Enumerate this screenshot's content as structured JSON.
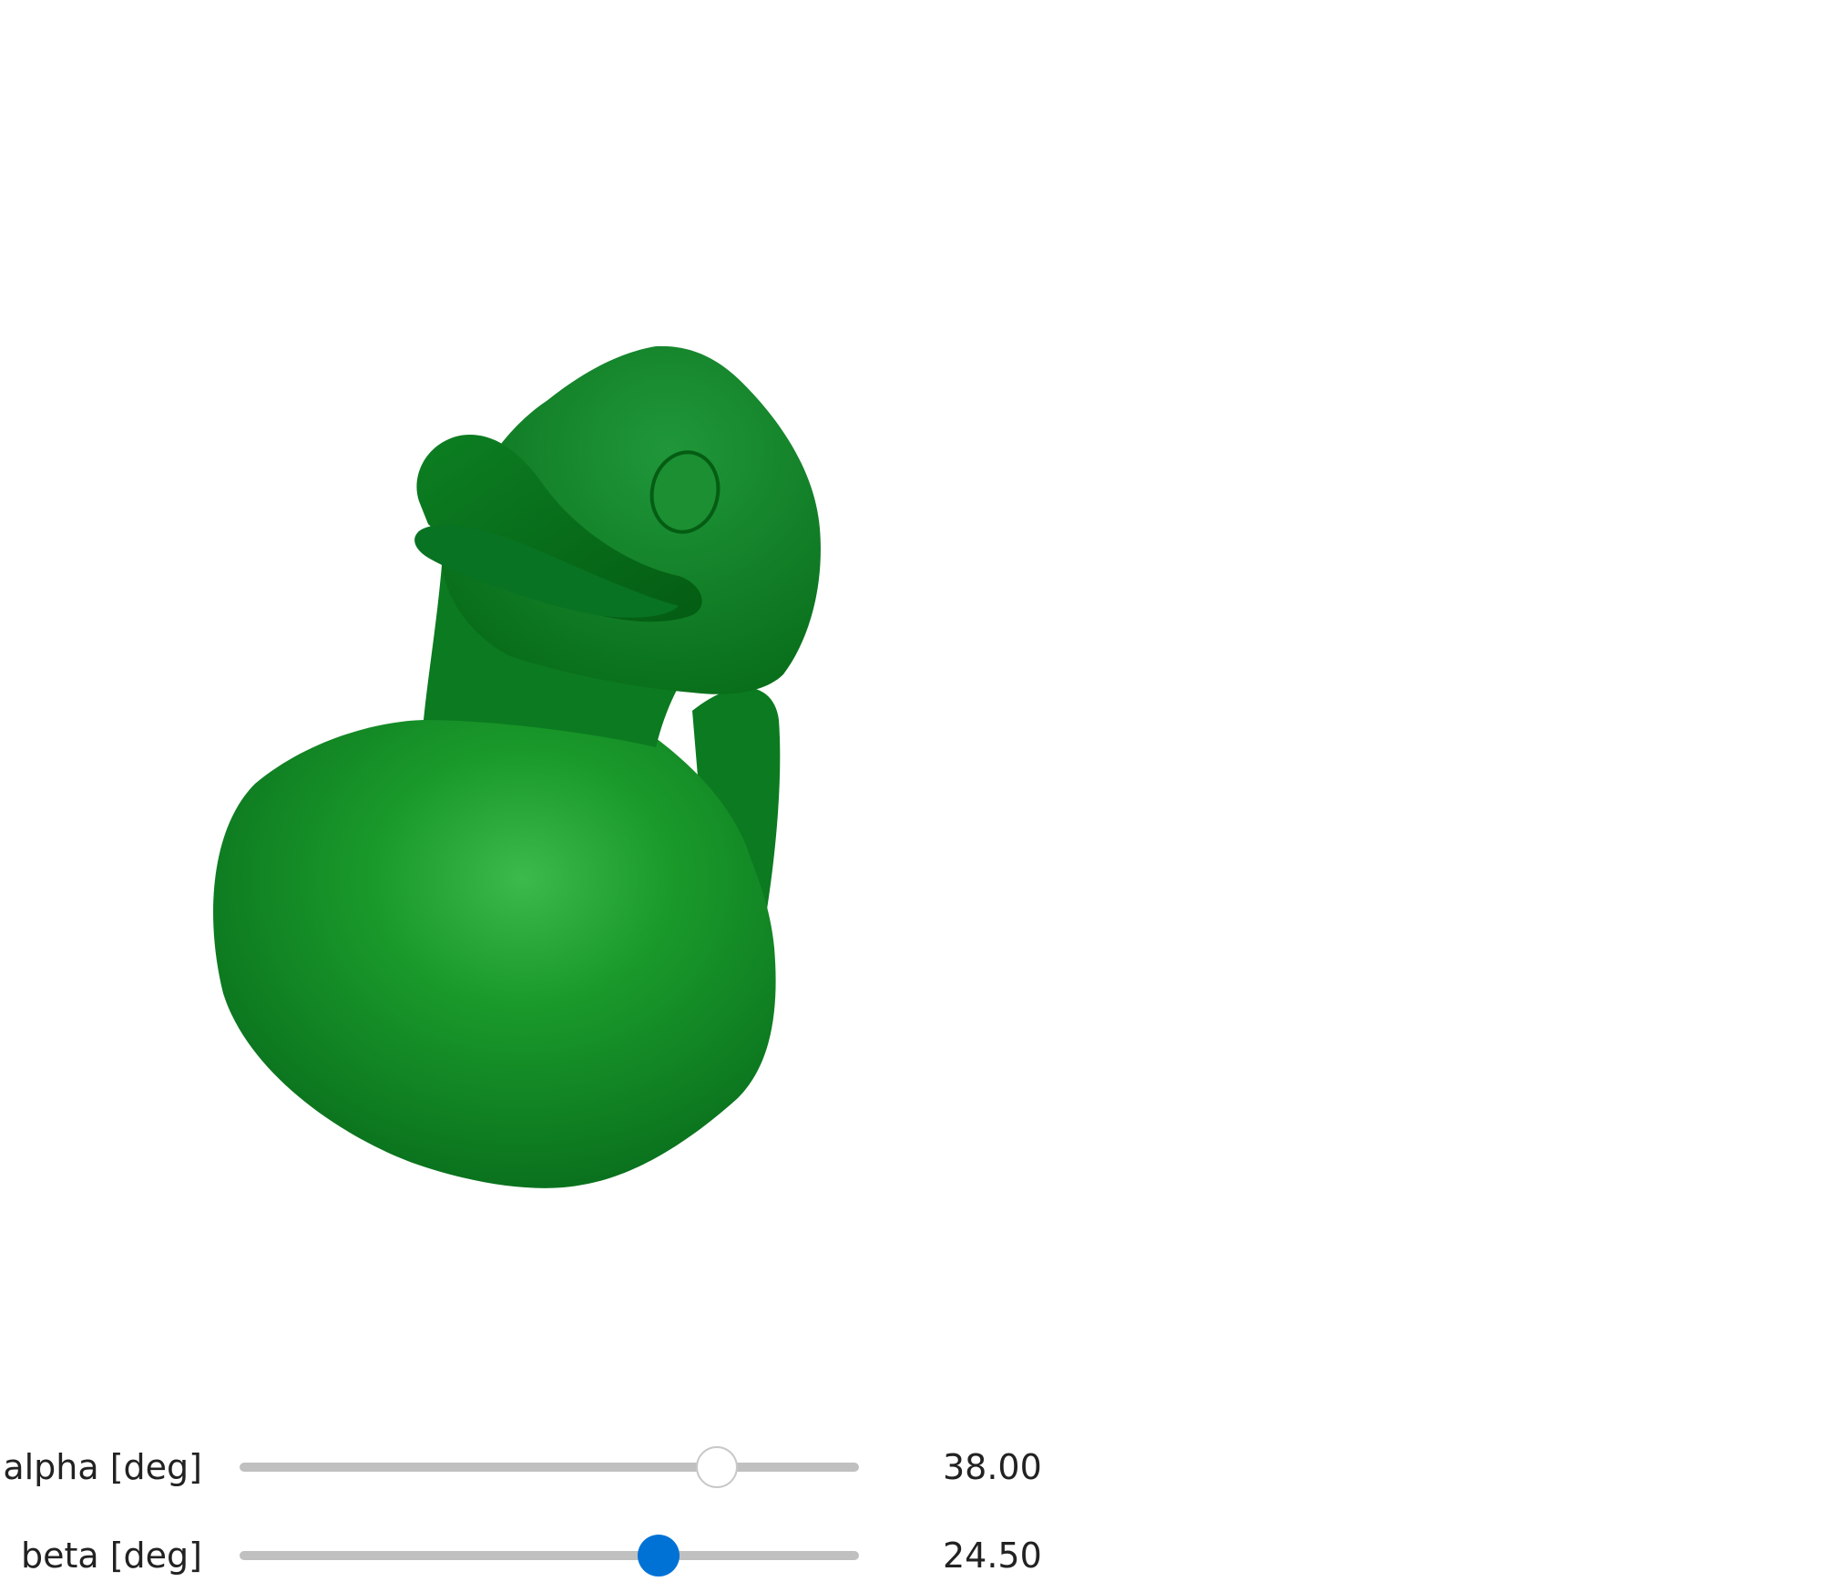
{
  "scene": {
    "model": "rubber duck",
    "color": "#0b7d1d"
  },
  "sliders": [
    {
      "label": "alpha [deg]",
      "value": "38.00",
      "fraction": 0.77,
      "active": false
    },
    {
      "label": "beta [deg]",
      "value": "24.50",
      "fraction": 0.676,
      "active": true
    }
  ],
  "colors": {
    "track": "#c0c0c0",
    "thumb_active": "#0072d6",
    "thumb_idle": "#ffffff"
  }
}
